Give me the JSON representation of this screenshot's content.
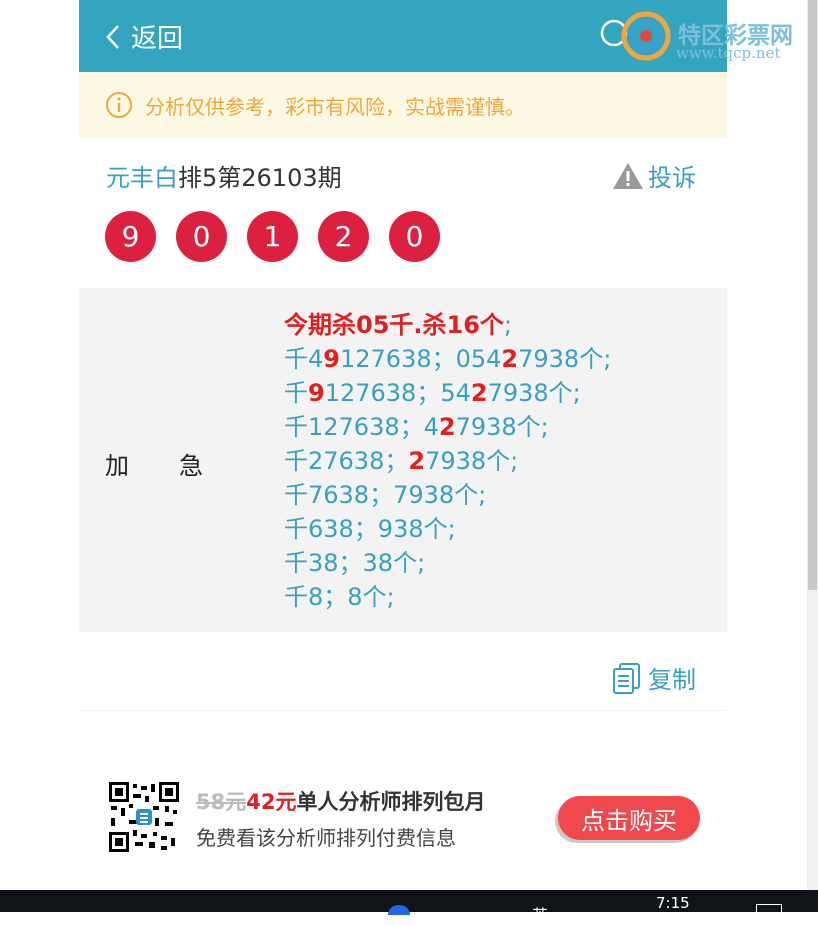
{
  "header": {
    "back_label": "返回"
  },
  "notice": {
    "text": "分析仅供参考，彩市有风险，实战需谨慎。"
  },
  "issue": {
    "author": "元丰白",
    "title": "排5第26103期",
    "complain_label": "投诉"
  },
  "balls": [
    "9",
    "0",
    "1",
    "2",
    "0"
  ],
  "panel": {
    "label": [
      "加",
      "急"
    ],
    "head_line": "今期杀05千.杀16个",
    "head_tail": ";",
    "lines": [
      [
        {
          "t": "千4",
          "r": false
        },
        {
          "t": "9",
          "r": true
        },
        {
          "t": "127638；054",
          "r": false
        },
        {
          "t": "2",
          "r": true
        },
        {
          "t": "7938个;",
          "r": false
        }
      ],
      [
        {
          "t": "千",
          "r": false
        },
        {
          "t": "9",
          "r": true
        },
        {
          "t": "127638；54",
          "r": false
        },
        {
          "t": "2",
          "r": true
        },
        {
          "t": "7938个;",
          "r": false
        }
      ],
      [
        {
          "t": "千127638；4",
          "r": false
        },
        {
          "t": "2",
          "r": true
        },
        {
          "t": "7938个;",
          "r": false
        }
      ],
      [
        {
          "t": "千27638；",
          "r": false
        },
        {
          "t": "2",
          "r": true
        },
        {
          "t": "7938个;",
          "r": false
        }
      ],
      [
        {
          "t": "千7638；7938个;",
          "r": false
        }
      ],
      [
        {
          "t": "千638；938个;",
          "r": false
        }
      ],
      [
        {
          "t": "千38；38个;",
          "r": false
        }
      ],
      [
        {
          "t": "千8；8个;",
          "r": false
        }
      ]
    ]
  },
  "copy_label": "复制",
  "promo": {
    "old_price": "58元",
    "new_price": "42元",
    "title": "单人分析师排列包月",
    "subtitle": "免费看该分析师排列付费信息",
    "buy_label": "点击购买"
  },
  "watermark": {
    "name": "特区彩票网",
    "url": "www.tqcp.net"
  },
  "taskbar": {
    "time": "7:15",
    "text": "英"
  },
  "colors": {
    "header": "#34a5bf",
    "ball": "#dc2040",
    "accent": "#3a9fc0",
    "red": "#e02020",
    "buy": "#f0484c"
  }
}
